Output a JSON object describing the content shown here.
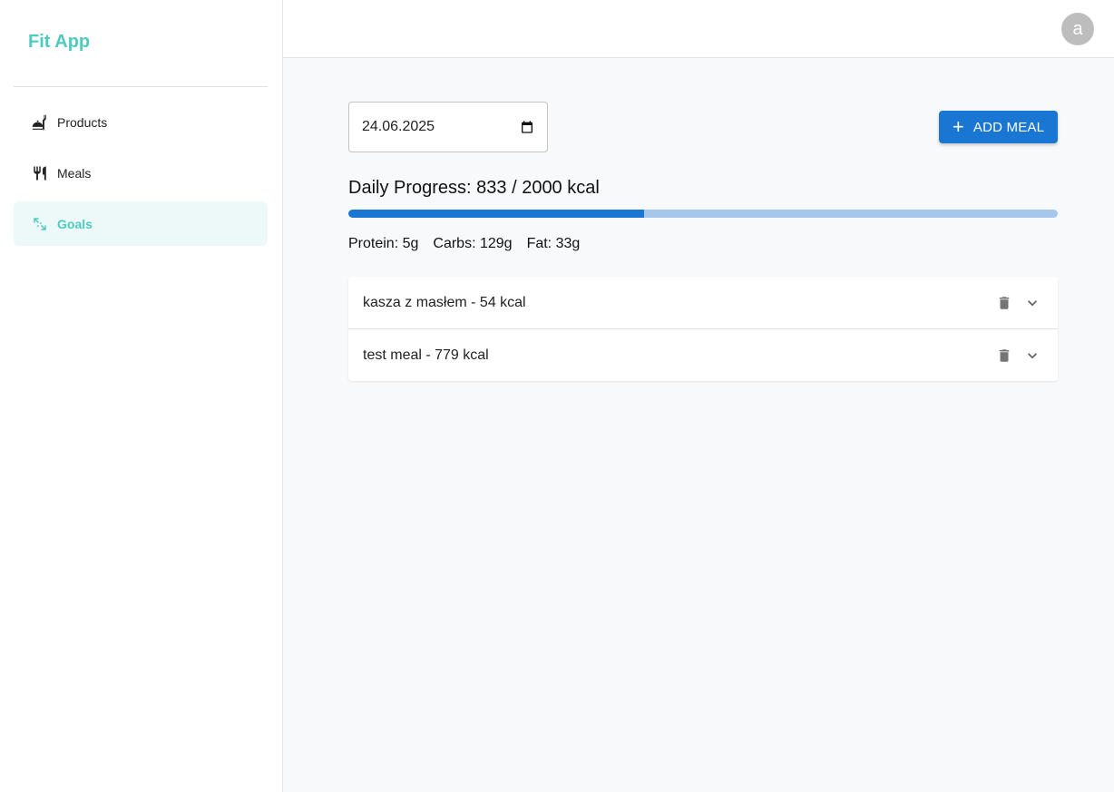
{
  "app": {
    "title": "Fit App"
  },
  "sidebar": {
    "items": [
      {
        "label": "Products",
        "icon": "food-tray-icon",
        "active": false
      },
      {
        "label": "Meals",
        "icon": "fork-knife-icon",
        "active": false
      },
      {
        "label": "Goals",
        "icon": "expand-arrows-icon",
        "active": true
      }
    ]
  },
  "topbar": {
    "avatar_letter": "a"
  },
  "main": {
    "date_value": "24.06.2025",
    "add_meal_label": "ADD MEAL",
    "progress": {
      "title": "Daily Progress: 833 / 2000 kcal",
      "consumed": 833,
      "goal": 2000
    },
    "macros": {
      "protein": "Protein: 5g",
      "carbs": "Carbs: 129g",
      "fat": "Fat: 33g"
    },
    "meals": [
      {
        "label": "kasza z masłem - 54 kcal"
      },
      {
        "label": "test meal - 779 kcal"
      }
    ]
  },
  "colors": {
    "brand": "#4ecbc0",
    "primary": "#1976d2",
    "progress_track": "#a5c7ec",
    "active_nav_bg": "#ecf9f8"
  }
}
